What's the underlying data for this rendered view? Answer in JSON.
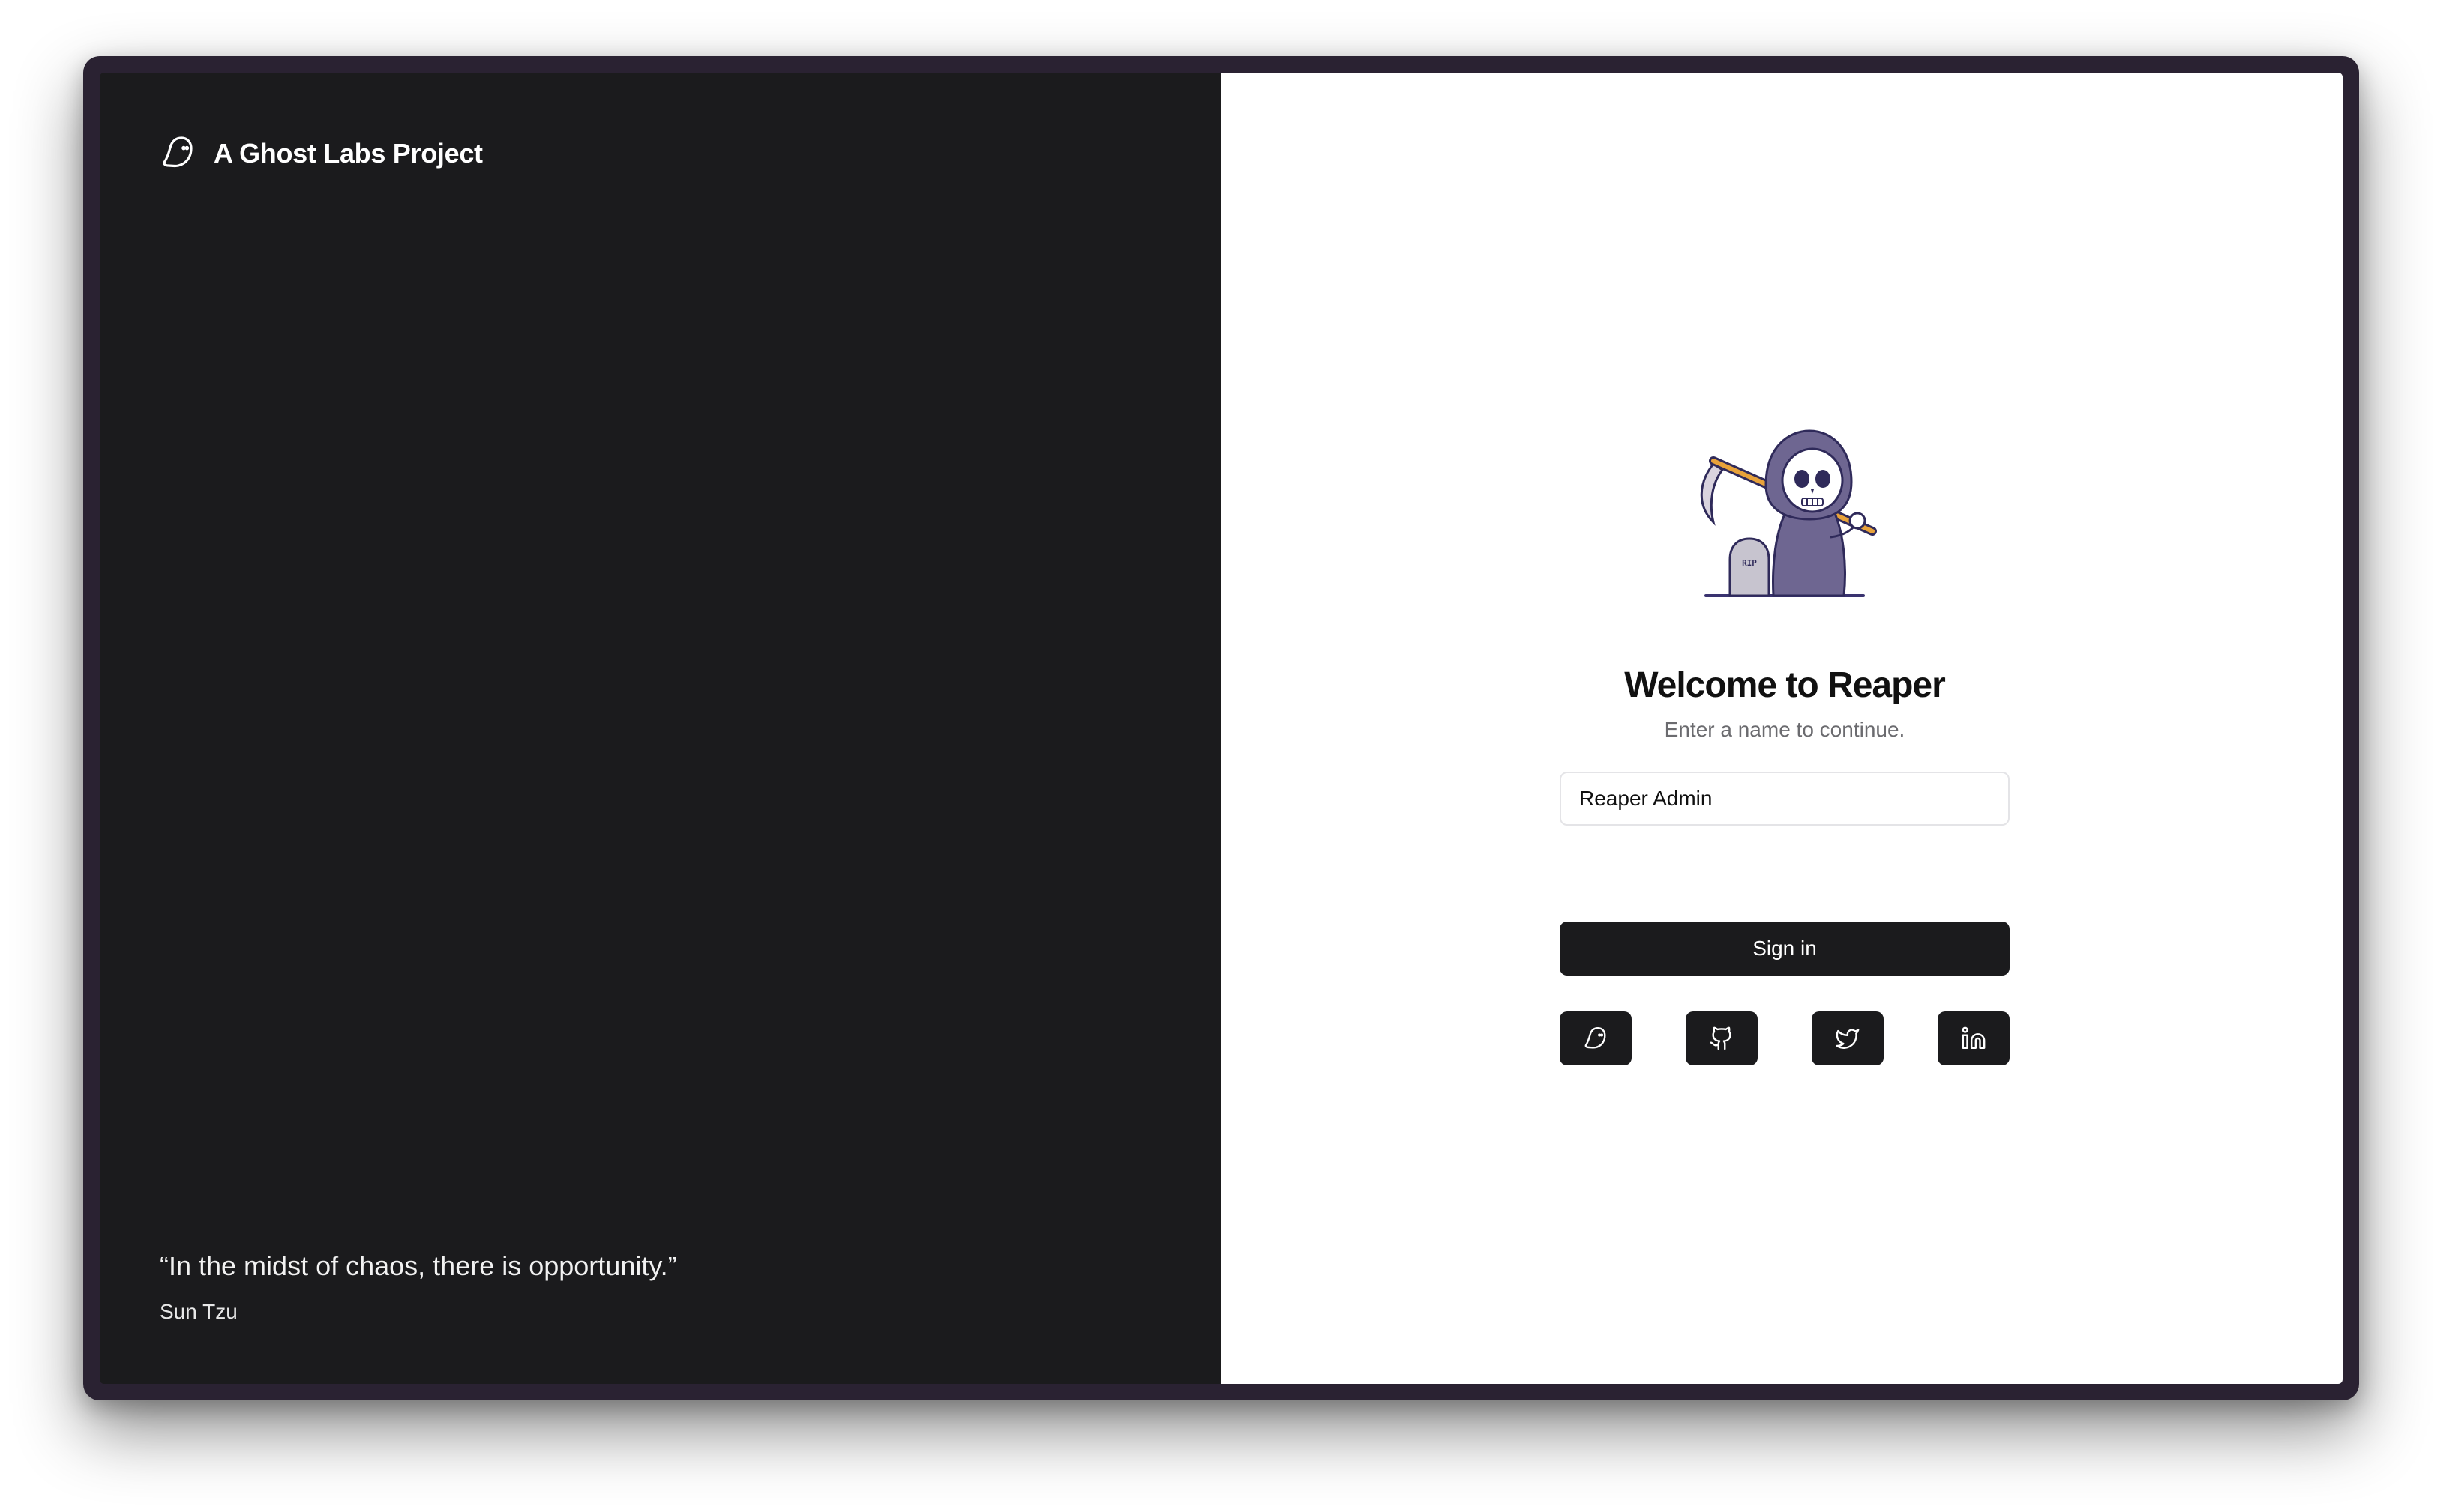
{
  "brand": {
    "name": "A Ghost Labs Project",
    "icon": "ghost-icon"
  },
  "quote": {
    "text": "“In the midst of chaos, there is opportunity.”",
    "author": "Sun Tzu"
  },
  "auth": {
    "mascot": "grim-reaper-illustration",
    "title": "Welcome to Reaper",
    "subtitle": "Enter a name to continue.",
    "name_input": {
      "value": "Reaper Admin",
      "placeholder": ""
    },
    "signin_label": "Sign in",
    "social_buttons": [
      {
        "icon": "ghost-icon"
      },
      {
        "icon": "github-icon"
      },
      {
        "icon": "twitter-icon"
      },
      {
        "icon": "linkedin-icon"
      }
    ]
  },
  "colors": {
    "left_panel_bg": "#1b1b1d",
    "frame": "#2a2232",
    "button_bg": "#1b1b1d",
    "subtitle": "#6b6b6f"
  }
}
